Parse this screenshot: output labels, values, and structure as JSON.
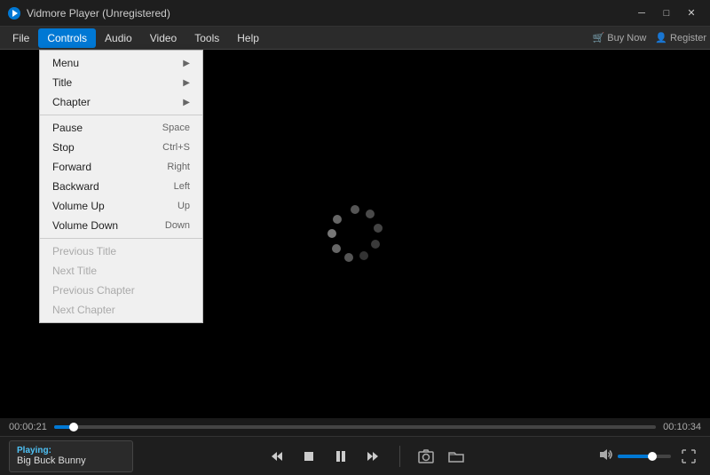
{
  "titlebar": {
    "title": "Vidmore Player (Unregistered)",
    "minimize_label": "─",
    "restore_label": "□",
    "close_label": "✕"
  },
  "menubar": {
    "items": [
      {
        "id": "file",
        "label": "File"
      },
      {
        "id": "controls",
        "label": "Controls",
        "active": true
      },
      {
        "id": "audio",
        "label": "Audio"
      },
      {
        "id": "video",
        "label": "Video"
      },
      {
        "id": "tools",
        "label": "Tools"
      },
      {
        "id": "help",
        "label": "Help"
      }
    ],
    "buy_now": "Buy Now",
    "register": "Register"
  },
  "dropdown": {
    "items": [
      {
        "label": "Menu",
        "shortcut": "",
        "arrow": true,
        "disabled": false
      },
      {
        "label": "Title",
        "shortcut": "",
        "arrow": true,
        "disabled": false
      },
      {
        "label": "Chapter",
        "shortcut": "",
        "arrow": true,
        "disabled": false
      },
      {
        "type": "separator"
      },
      {
        "label": "Pause",
        "shortcut": "Space",
        "disabled": false
      },
      {
        "label": "Stop",
        "shortcut": "Ctrl+S",
        "disabled": false
      },
      {
        "label": "Forward",
        "shortcut": "Right",
        "disabled": false
      },
      {
        "label": "Backward",
        "shortcut": "Left",
        "disabled": false
      },
      {
        "label": "Volume Up",
        "shortcut": "Up",
        "disabled": false
      },
      {
        "label": "Volume Down",
        "shortcut": "Down",
        "disabled": false
      },
      {
        "type": "separator"
      },
      {
        "label": "Previous Title",
        "shortcut": "",
        "disabled": true
      },
      {
        "label": "Next Title",
        "shortcut": "",
        "disabled": true
      },
      {
        "label": "Previous Chapter",
        "shortcut": "",
        "disabled": true
      },
      {
        "label": "Next Chapter",
        "shortcut": "",
        "disabled": true
      }
    ]
  },
  "progress": {
    "current_time": "00:00:21",
    "total_time": "00:10:34"
  },
  "controls": {
    "rewind": "⏮",
    "stop": "■",
    "play_pause": "⏸",
    "forward": "⏭",
    "screenshot": "📷",
    "folder": "📁"
  },
  "now_playing": {
    "label": "Playing:",
    "title": "Big Buck Bunny"
  },
  "volume": {
    "level": 65
  }
}
